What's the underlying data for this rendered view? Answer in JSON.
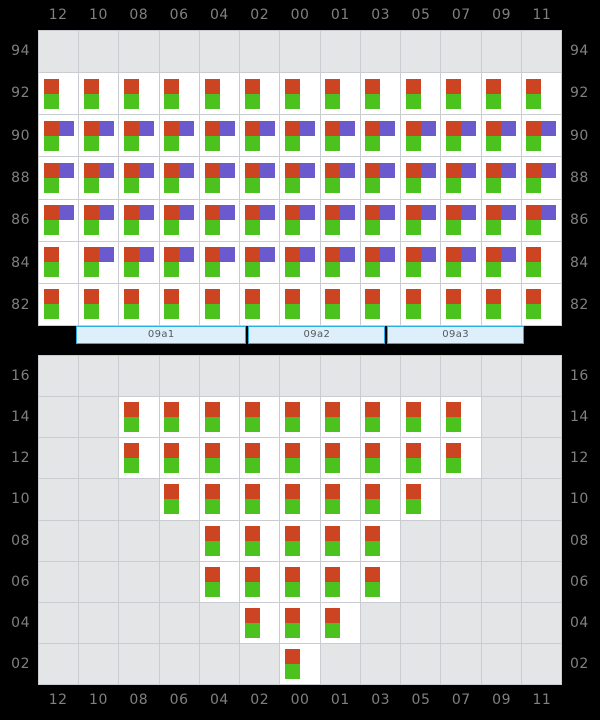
{
  "theme": {
    "background": "#000000",
    "cell_empty": "#e4e5e7",
    "cell_filled": "#ffffff",
    "grid_line": "#c9ccd1",
    "axis_text": "#808080",
    "group_border": "#29ade4",
    "group_fill": "#ddeffb",
    "group_text": "#555a5e"
  },
  "glyph_colors": {
    "red": "#cc4422",
    "green": "#4cc21f",
    "purple": "#6a5acd"
  },
  "charts": [
    {
      "id": "chart-top",
      "x_labels": [
        "12",
        "10",
        "08",
        "06",
        "04",
        "02",
        "00",
        "01",
        "03",
        "05",
        "07",
        "09",
        "11"
      ],
      "y_labels": [
        "94",
        "92",
        "90",
        "88",
        "86",
        "84",
        "82"
      ],
      "groups": [
        {
          "label": "09a1",
          "span": 5
        },
        {
          "label": "09a2",
          "span": 4
        },
        {
          "label": "09a3",
          "span": 4
        }
      ],
      "rows": [
        {
          "y": "94",
          "cells": [
            "",
            "",
            "",
            "",
            "",
            "",
            "",
            "",
            "",
            "",
            "",
            "",
            ""
          ]
        },
        {
          "y": "92",
          "cells": [
            "rg",
            "rg",
            "rg",
            "rg",
            "rg",
            "rg",
            "rg",
            "rg",
            "rg",
            "rg",
            "rg",
            "rg",
            "rg"
          ]
        },
        {
          "y": "90",
          "cells": [
            "rpg",
            "rpg",
            "rpg",
            "rpg",
            "rpg",
            "rpg",
            "rpg",
            "rpg",
            "rpg",
            "rpg",
            "rpg",
            "rpg",
            "rpg"
          ]
        },
        {
          "y": "88",
          "cells": [
            "rpg",
            "rpg",
            "rpg",
            "rpg",
            "rpg",
            "rpg",
            "rpg",
            "rpg",
            "rpg",
            "rpg",
            "rpg",
            "rpg",
            "rpg"
          ]
        },
        {
          "y": "86",
          "cells": [
            "rpg",
            "rpg",
            "rpg",
            "rpg",
            "rpg",
            "rpg",
            "rpg",
            "rpg",
            "rpg",
            "rpg",
            "rpg",
            "rpg",
            "rpg"
          ]
        },
        {
          "y": "84",
          "cells": [
            "rg",
            "rpg",
            "rpg",
            "rpg",
            "rpg",
            "rpg",
            "rpg",
            "rpg",
            "rpg",
            "rpg",
            "rpg",
            "rpg",
            "rg"
          ]
        },
        {
          "y": "82",
          "cells": [
            "rg",
            "rg",
            "rg",
            "rg",
            "rg",
            "rg",
            "rg",
            "rg",
            "rg",
            "rg",
            "rg",
            "rg",
            "rg"
          ]
        }
      ]
    },
    {
      "id": "chart-bottom",
      "x_labels": [
        "12",
        "10",
        "08",
        "06",
        "04",
        "02",
        "00",
        "01",
        "03",
        "05",
        "07",
        "09",
        "11"
      ],
      "y_labels": [
        "16",
        "14",
        "12",
        "10",
        "08",
        "06",
        "04",
        "02"
      ],
      "groups": [],
      "rows": [
        {
          "y": "16",
          "cells": [
            "",
            "",
            "",
            "",
            "",
            "",
            "",
            "",
            "",
            "",
            "",
            "",
            ""
          ]
        },
        {
          "y": "14",
          "cells": [
            "",
            "",
            "rg",
            "rg",
            "rg",
            "rg",
            "rg",
            "rg",
            "rg",
            "rg",
            "rg",
            "",
            ""
          ]
        },
        {
          "y": "12",
          "cells": [
            "",
            "",
            "rg",
            "rg",
            "rg",
            "rg",
            "rg",
            "rg",
            "rg",
            "rg",
            "rg",
            "",
            ""
          ]
        },
        {
          "y": "10",
          "cells": [
            "",
            "",
            "",
            "rg",
            "rg",
            "rg",
            "rg",
            "rg",
            "rg",
            "rg",
            "",
            "",
            ""
          ]
        },
        {
          "y": "08",
          "cells": [
            "",
            "",
            "",
            "",
            "rg",
            "rg",
            "rg",
            "rg",
            "rg",
            "",
            "",
            "",
            ""
          ]
        },
        {
          "y": "06",
          "cells": [
            "",
            "",
            "",
            "",
            "rg",
            "rg",
            "rg",
            "rg",
            "rg",
            "",
            "",
            "",
            ""
          ]
        },
        {
          "y": "04",
          "cells": [
            "",
            "",
            "",
            "",
            "",
            "rg",
            "rg",
            "rg",
            "",
            "",
            "",
            "",
            ""
          ]
        },
        {
          "y": "02",
          "cells": [
            "",
            "",
            "",
            "",
            "",
            "",
            "rg",
            "",
            "",
            "",
            "",
            "",
            ""
          ]
        }
      ]
    }
  ]
}
